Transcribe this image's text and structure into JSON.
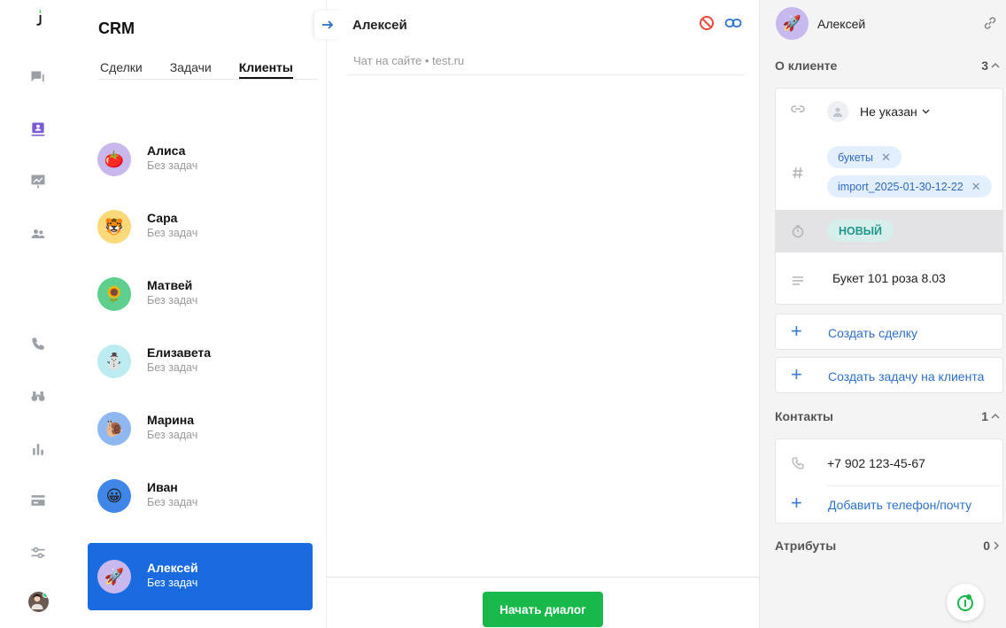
{
  "app": {
    "section_title": "CRM"
  },
  "tabs": [
    {
      "label": "Сделки"
    },
    {
      "label": "Задачи"
    },
    {
      "label": "Клиенты"
    }
  ],
  "clients": [
    {
      "name": "Алиса",
      "sub": "Без задач",
      "avatar": "tomato-icon",
      "emoji": "🍅",
      "bg": "#c9b8ee"
    },
    {
      "name": "Сара",
      "sub": "Без задач",
      "avatar": "tiger-icon",
      "emoji": "🐯",
      "bg": "#f9d978"
    },
    {
      "name": "Матвей",
      "sub": "Без задач",
      "avatar": "sunflower-icon",
      "emoji": "🌻",
      "bg": "#5fcf8d"
    },
    {
      "name": "Елизавета",
      "sub": "Без задач",
      "avatar": "snowman-icon",
      "emoji": "⛄",
      "bg": "#bdebf2"
    },
    {
      "name": "Марина",
      "sub": "Без задач",
      "avatar": "snail-icon",
      "emoji": "🐌",
      "bg": "#8fb7f1"
    },
    {
      "name": "Иван",
      "sub": "Без задач",
      "avatar": "smile-icon",
      "emoji": "😀",
      "bg": "#3f86e8"
    },
    {
      "name": "Алексей",
      "sub": "Без задач",
      "avatar": "rocket-icon",
      "emoji": "🚀",
      "bg": "#c9b8ee"
    }
  ],
  "chat": {
    "name": "Алексей",
    "source": "Чат на сайте • test.ru",
    "start_button": "Начать диалог"
  },
  "panel": {
    "name": "Алексей",
    "avatar_emoji": "🚀",
    "about": {
      "title": "О клиенте",
      "count": "3"
    },
    "assignee": "Не указан",
    "tags": [
      "букеты",
      "import_2025-01-30-12-22"
    ],
    "tag_remove": "✕",
    "status": "НОВЫЙ",
    "note": "Букет 101 роза 8.03",
    "create_deal": "Создать сделку",
    "create_task": "Создать задачу на клиента",
    "contacts": {
      "title": "Контакты",
      "count": "1"
    },
    "phone": "+7 902 123-45-67",
    "add_contact": "Добавить телефон/почту",
    "attributes": {
      "title": "Атрибуты",
      "count": "0"
    },
    "plus": "+"
  },
  "colors": {
    "accent": "#1b6be0",
    "success": "#19b84a",
    "danger": "#e64a3b",
    "rail_active": "#7b5cd6"
  }
}
